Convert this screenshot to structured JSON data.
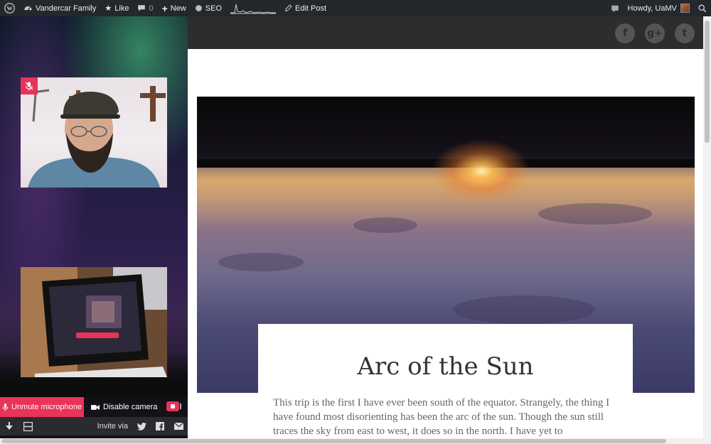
{
  "admin_bar": {
    "site_name": "Vandercar Family",
    "like_label": "Like",
    "comments_count": "0",
    "new_label": "New",
    "seo_label": "SEO",
    "edit_post_label": "Edit Post",
    "greeting": "Howdy, UaMV",
    "icons": [
      "wordpress-icon",
      "dashboard-icon",
      "star-icon",
      "comment-icon",
      "plus-icon",
      "seo-circle-icon",
      "stats-sparkline-icon",
      "pencil-icon",
      "notification-icon",
      "search-icon"
    ]
  },
  "video_chat": {
    "self_video_badge": "mic-muted-icon",
    "unmute_label": "Unmute microphone",
    "disable_camera_label": "Disable camera",
    "invite_label": "Invite via",
    "accent_color": "#e8335a"
  },
  "social": {
    "facebook": "f",
    "google_plus": "g+",
    "twitter": "t"
  },
  "post": {
    "title": "Arc of the Sun",
    "body": "This trip is the first I have ever been south of the equator. Strangely, the thing I have found most disorienting has been the arc of the sun. Though the sun still traces the sky from east to west, it does so in the north. I have yet to"
  }
}
